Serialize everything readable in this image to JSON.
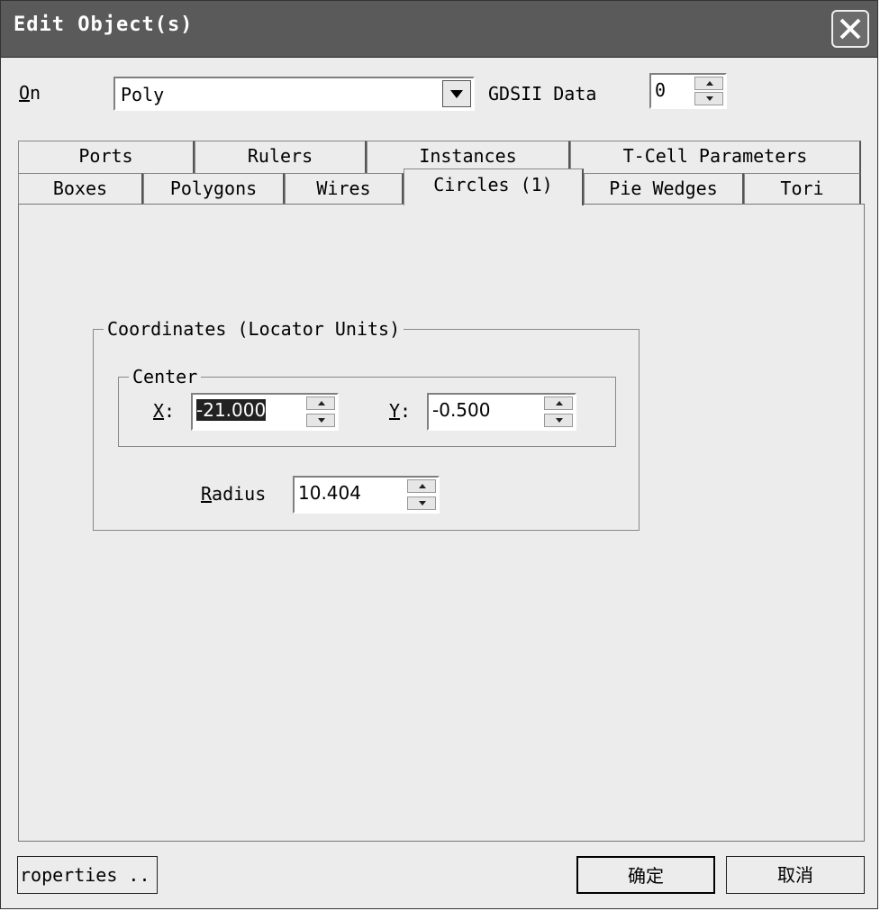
{
  "window": {
    "title": "Edit Object(s)"
  },
  "on_row": {
    "on_label_key": "O",
    "on_label_rest": "n",
    "layer_value": "Poly",
    "gdsii_label": "GDSII Data",
    "gdsii_value": "0"
  },
  "tabs": {
    "row_back": [
      "Ports",
      "Rulers",
      "Instances",
      "T-Cell Parameters"
    ],
    "row_front": [
      "Boxes",
      "Polygons",
      "Wires",
      "Circles (1)",
      "Pie Wedges",
      "Tori"
    ],
    "active": "Circles (1)"
  },
  "coordinates": {
    "group_label": "Coordinates (Locator Units)",
    "center_label": "Center",
    "x_key": "X",
    "x_rest": ":",
    "x_value": "-21.000",
    "y_key": "Y",
    "y_rest": ":",
    "y_value": "-0.500",
    "radius_key": "R",
    "radius_rest": "adius",
    "radius_value": "10.404"
  },
  "footer": {
    "properties_label": "roperties ..",
    "ok_label": "确定",
    "cancel_label": "取消"
  }
}
